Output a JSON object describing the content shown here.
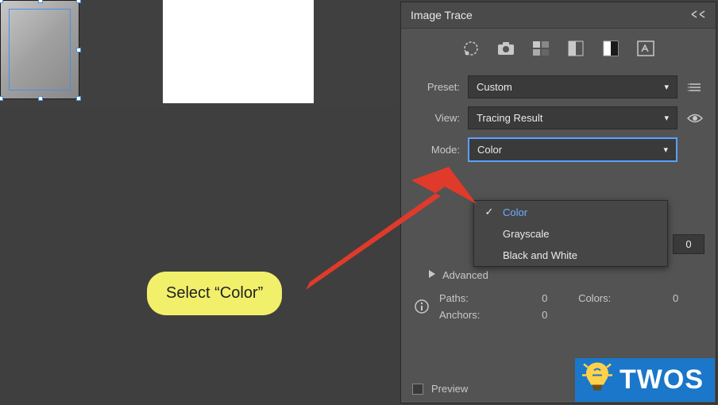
{
  "panel": {
    "title": "Image Trace",
    "icons": [
      "auto-color",
      "camera",
      "grid-6",
      "grayscale",
      "bw",
      "outline"
    ],
    "preset": {
      "label": "Preset:",
      "value": "Custom"
    },
    "view": {
      "label": "View:",
      "value": "Tracing Result"
    },
    "mode": {
      "label": "Mode:",
      "value": "Color"
    },
    "mode_options": [
      "Color",
      "Grayscale",
      "Black and White"
    ],
    "colors_field_value": "0",
    "advanced": "Advanced",
    "stats": {
      "paths_label": "Paths:",
      "paths_value": "0",
      "colors_label": "Colors:",
      "colors_value": "0",
      "anchors_label": "Anchors:",
      "anchors_value": "0"
    },
    "preview": "Preview"
  },
  "callout": "Select “Color”",
  "watermark": "TWOS"
}
